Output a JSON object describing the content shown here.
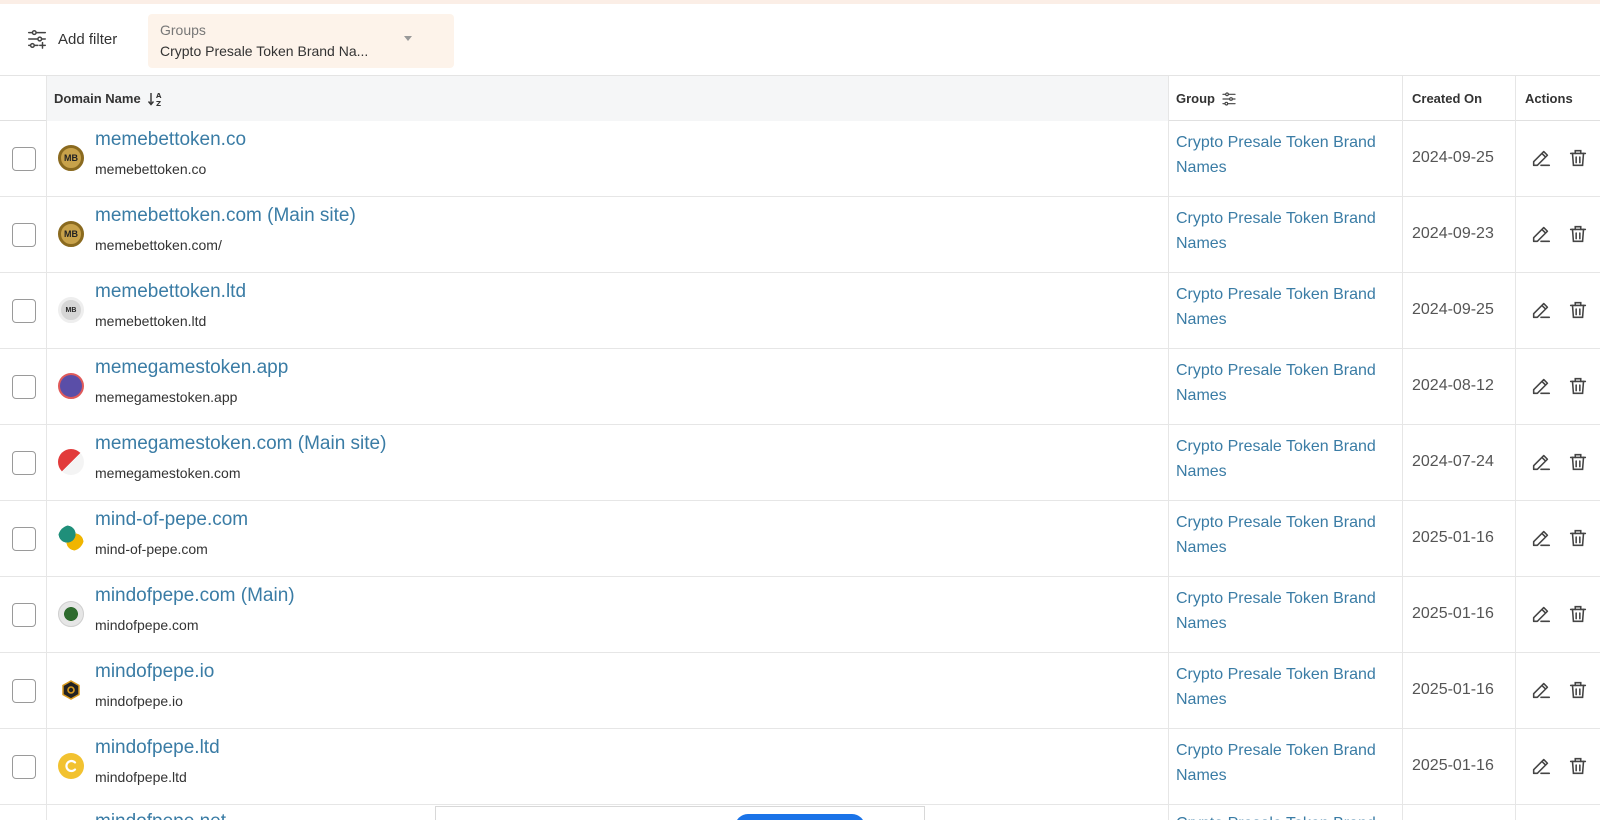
{
  "filter_bar": {
    "add_filter_label": "Add filter",
    "groups_label": "Groups",
    "groups_value": "Crypto Presale Token Brand Na..."
  },
  "table": {
    "headers": {
      "domain": "Domain Name",
      "group": "Group",
      "created": "Created On",
      "actions": "Actions"
    },
    "rows": [
      {
        "title": "memebettoken.co",
        "url": "memebettoken.co",
        "group": "Crypto Presale Token Brand Names",
        "created": "2024-09-25"
      },
      {
        "title": "memebettoken.com (Main site)",
        "url": "memebettoken.com/",
        "group": "Crypto Presale Token Brand Names",
        "created": "2024-09-23"
      },
      {
        "title": "memebettoken.ltd",
        "url": "memebettoken.ltd",
        "group": "Crypto Presale Token Brand Names",
        "created": "2024-09-25"
      },
      {
        "title": "memegamestoken.app",
        "url": "memegamestoken.app",
        "group": "Crypto Presale Token Brand Names",
        "created": "2024-08-12"
      },
      {
        "title": "memegamestoken.com (Main site)",
        "url": "memegamestoken.com",
        "group": "Crypto Presale Token Brand Names",
        "created": "2024-07-24"
      },
      {
        "title": "mind-of-pepe.com",
        "url": "mind-of-pepe.com",
        "group": "Crypto Presale Token Brand Names",
        "created": "2025-01-16"
      },
      {
        "title": "mindofpepe.com (Main)",
        "url": "mindofpepe.com",
        "group": "Crypto Presale Token Brand Names",
        "created": "2025-01-16"
      },
      {
        "title": "mindofpepe.io",
        "url": "mindofpepe.io",
        "group": "Crypto Presale Token Brand Names",
        "created": "2025-01-16"
      },
      {
        "title": "mindofpepe.ltd",
        "url": "mindofpepe.ltd",
        "group": "Crypto Presale Token Brand Names",
        "created": "2025-01-16"
      }
    ],
    "partial_row": {
      "title": "mindofpepe.net",
      "group": "Crypto Presale Token Brand"
    }
  },
  "favicons": {
    "row0": "MB",
    "row1": "MB",
    "row2": "MB"
  },
  "colors": {
    "link": "#3a7ca5",
    "chip_bg": "#fdf3ea",
    "header_highlight": "#f5f6f7",
    "overlay_button": "#1a73e8"
  },
  "icons": [
    "filter-sliders-icon",
    "sort-az-icon",
    "group-filter-icon",
    "edit-icon",
    "trash-icon",
    "chevron-down-icon"
  ]
}
